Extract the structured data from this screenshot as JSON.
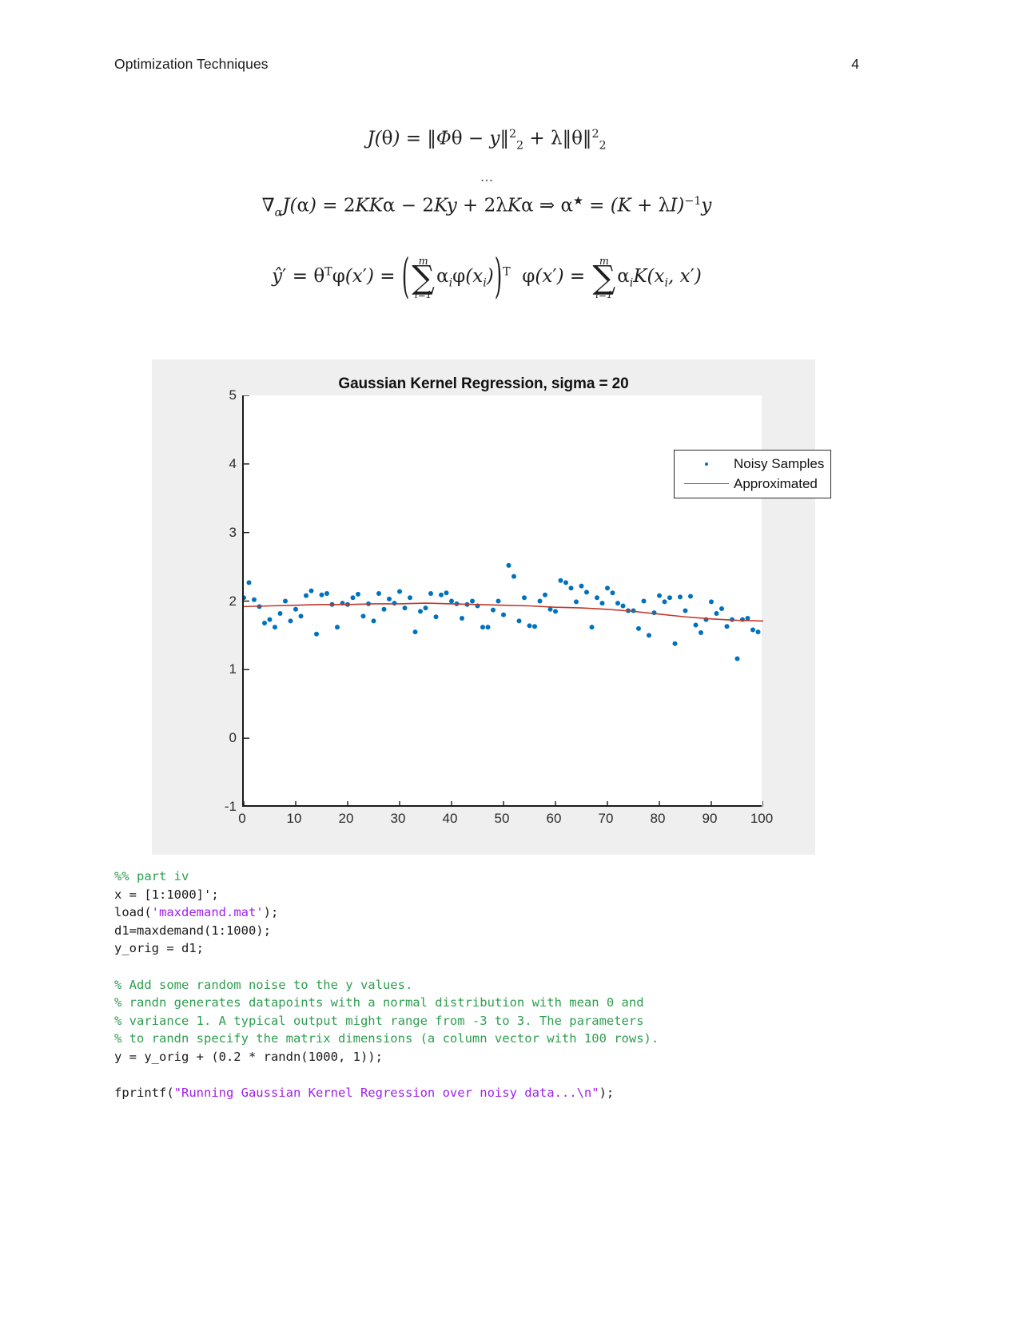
{
  "header": {
    "title": "Optimization Techniques",
    "page_number": "4"
  },
  "equations": {
    "eq1_text": "J(θ) = ‖Φθ − y‖²₂ + λ‖θ‖²₂",
    "ellipsis": "...",
    "eq2_text": "∇αJ(α) = 2KKα − 2Ky + 2λKα ⇒ α* = (K + λI)⁻¹y",
    "eq3_text": "ŷ′ = θᵀφ(x′) = (Σ αiφ(xi))ᵀ φ(x′) = Σ αiK(xi, x′)"
  },
  "figure": {
    "title": "Gaussian Kernel Regression, sigma = 20",
    "legend": [
      {
        "label": "Noisy Samples",
        "marker": "dot",
        "color": "#0072bd"
      },
      {
        "label": "Approximated",
        "marker": "line",
        "color": "#c0392b"
      }
    ]
  },
  "chart_data": {
    "type": "scatter",
    "title": "Gaussian Kernel Regression, sigma = 20",
    "xlabel": "",
    "ylabel": "",
    "xlim": [
      0,
      100
    ],
    "ylim": [
      -1,
      5
    ],
    "xticks": [
      0,
      10,
      20,
      30,
      40,
      50,
      60,
      70,
      80,
      90,
      100
    ],
    "yticks": [
      -1,
      0,
      1,
      2,
      3,
      4,
      5
    ],
    "grid": false,
    "legend_position": "upper right",
    "series": [
      {
        "name": "Noisy Samples",
        "type": "scatter",
        "color": "#0072bd",
        "marker_size": 3,
        "x": [
          0,
          1,
          2,
          3,
          4,
          5,
          6,
          7,
          8,
          9,
          10,
          11,
          12,
          13,
          14,
          15,
          16,
          17,
          18,
          19,
          20,
          21,
          22,
          23,
          24,
          25,
          26,
          27,
          28,
          29,
          30,
          31,
          32,
          33,
          34,
          35,
          36,
          37,
          38,
          39,
          40,
          41,
          42,
          43,
          44,
          45,
          46,
          47,
          48,
          49,
          50,
          51,
          52,
          53,
          54,
          55,
          56,
          57,
          58,
          59,
          60,
          61,
          62,
          63,
          64,
          65,
          66,
          67,
          68,
          69,
          70,
          71,
          72,
          73,
          74,
          75,
          76,
          77,
          78,
          79,
          80,
          81,
          82,
          83,
          84,
          85,
          86,
          87,
          88,
          89,
          90,
          91,
          92,
          93,
          94,
          95,
          96,
          97,
          98,
          99
        ],
        "y": [
          2.05,
          2.27,
          2.02,
          1.92,
          1.68,
          1.73,
          1.62,
          1.82,
          2.0,
          1.71,
          1.88,
          1.78,
          2.08,
          2.15,
          1.52,
          2.09,
          2.11,
          1.95,
          1.62,
          1.97,
          1.95,
          2.05,
          2.1,
          1.78,
          1.96,
          1.71,
          2.11,
          1.88,
          2.03,
          1.97,
          2.14,
          1.9,
          2.05,
          1.55,
          1.85,
          1.9,
          2.11,
          1.77,
          2.09,
          2.12,
          2.0,
          1.96,
          1.75,
          1.95,
          2.0,
          1.93,
          1.62,
          1.62,
          1.87,
          2.0,
          1.8,
          2.52,
          2.36,
          1.71,
          2.05,
          1.64,
          1.63,
          2.0,
          2.09,
          1.88,
          1.85,
          2.3,
          2.27,
          2.19,
          1.99,
          2.22,
          2.13,
          1.62,
          2.05,
          1.97,
          2.19,
          2.12,
          1.97,
          1.93,
          1.86,
          1.86,
          1.6,
          2.0,
          1.5,
          1.83,
          2.08,
          1.99,
          2.05,
          1.38,
          2.06,
          1.86,
          2.07,
          1.65,
          1.54,
          1.73,
          1.99,
          1.82,
          1.89,
          1.63,
          1.73,
          1.16,
          1.73,
          1.75,
          1.58,
          1.55
        ]
      },
      {
        "name": "Approximated",
        "type": "line",
        "color": "#c0392b",
        "x": [
          0,
          5,
          10,
          15,
          20,
          25,
          30,
          35,
          40,
          45,
          50,
          55,
          60,
          65,
          70,
          75,
          80,
          85,
          90,
          95,
          100
        ],
        "y": [
          1.92,
          1.93,
          1.94,
          1.95,
          1.95,
          1.96,
          1.96,
          1.97,
          1.96,
          1.95,
          1.94,
          1.93,
          1.91,
          1.9,
          1.88,
          1.85,
          1.81,
          1.77,
          1.74,
          1.72,
          1.71
        ]
      }
    ]
  },
  "code": {
    "lines": [
      {
        "type": "comment",
        "text": "%% part iv"
      },
      {
        "type": "plain",
        "text": "x = [1:1000]';"
      },
      {
        "type": "mixed",
        "parts": [
          {
            "style": "plain",
            "text": "load("
          },
          {
            "style": "string",
            "text": "'maxdemand.mat'"
          },
          {
            "style": "plain",
            "text": ");"
          }
        ]
      },
      {
        "type": "plain",
        "text": "d1=maxdemand(1:1000);"
      },
      {
        "type": "plain",
        "text": "y_orig = d1;"
      },
      {
        "type": "blank",
        "text": ""
      },
      {
        "type": "comment",
        "text": "% Add some random noise to the y values."
      },
      {
        "type": "comment",
        "text": "% randn generates datapoints with a normal distribution with mean 0 and"
      },
      {
        "type": "comment",
        "text": "% variance 1. A typical output might range from -3 to 3. The parameters"
      },
      {
        "type": "comment",
        "text": "% to randn specify the matrix dimensions (a column vector with 100 rows)."
      },
      {
        "type": "plain",
        "text": "y = y_orig + (0.2 * randn(1000, 1));"
      },
      {
        "type": "blank",
        "text": ""
      },
      {
        "type": "mixed",
        "parts": [
          {
            "style": "plain",
            "text": "fprintf("
          },
          {
            "style": "string",
            "text": "\"Running Gaussian Kernel Regression over noisy data...\\n\""
          },
          {
            "style": "plain",
            "text": ");"
          }
        ]
      }
    ]
  }
}
